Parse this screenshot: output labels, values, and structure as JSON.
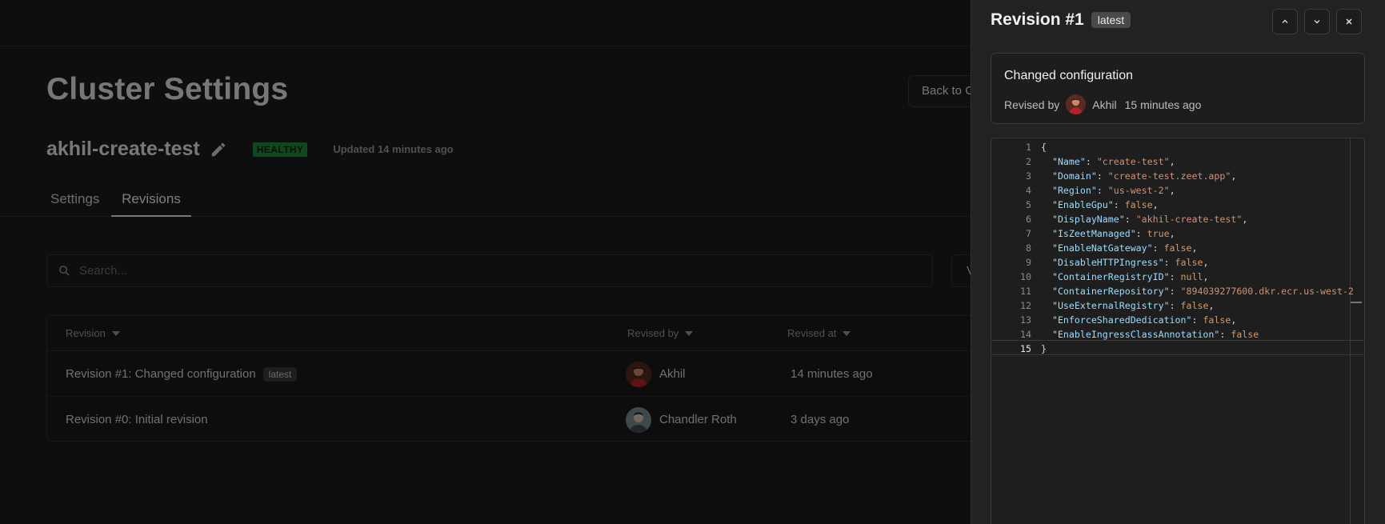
{
  "page": {
    "title": "Cluster Settings",
    "back_button": "Back to C",
    "cluster_name": "akhil-create-test",
    "health": "HEALTHY",
    "updated": "Updated 14 minutes ago",
    "tabs": [
      {
        "label": "Settings"
      },
      {
        "label": "Revisions",
        "active": true
      }
    ],
    "search_placeholder": "Search...",
    "view_button": "V",
    "table": {
      "headers": [
        "Revision",
        "Revised by",
        "Revised at"
      ],
      "rows": [
        {
          "revision": "Revision #1: Changed configuration",
          "badge": "latest",
          "user": "Akhil",
          "at": "14 minutes ago"
        },
        {
          "revision": "Revision #0: Initial revision",
          "badge": "",
          "user": "Chandler Roth",
          "at": "3 days ago"
        }
      ]
    }
  },
  "drawer": {
    "title": "Revision #1",
    "badge": "latest",
    "summary_title": "Changed configuration",
    "revised_by_label": "Revised by",
    "revised_by_user": "Akhil",
    "revised_time": "15 minutes ago",
    "active_line": 15,
    "code_lines": [
      {
        "n": "1",
        "parts": [
          [
            "p",
            "{"
          ]
        ]
      },
      {
        "n": "2",
        "parts": [
          [
            "p",
            "  "
          ],
          [
            "k",
            "\"Name\""
          ],
          [
            "p",
            ": "
          ],
          [
            "s",
            "\"create-test\""
          ],
          [
            "p",
            ","
          ]
        ]
      },
      {
        "n": "3",
        "parts": [
          [
            "p",
            "  "
          ],
          [
            "k",
            "\"Domain\""
          ],
          [
            "p",
            ": "
          ],
          [
            "s",
            "\"create-test.zeet.app\""
          ],
          [
            "p",
            ","
          ]
        ]
      },
      {
        "n": "4",
        "parts": [
          [
            "p",
            "  "
          ],
          [
            "k",
            "\"Region\""
          ],
          [
            "p",
            ": "
          ],
          [
            "s",
            "\"us-west-2\""
          ],
          [
            "p",
            ","
          ]
        ]
      },
      {
        "n": "5",
        "parts": [
          [
            "p",
            "  "
          ],
          [
            "k",
            "\"EnableGpu\""
          ],
          [
            "p",
            ": "
          ],
          [
            "b",
            "false"
          ],
          [
            "p",
            ","
          ]
        ]
      },
      {
        "n": "6",
        "parts": [
          [
            "p",
            "  "
          ],
          [
            "k",
            "\"DisplayName\""
          ],
          [
            "p",
            ": "
          ],
          [
            "s",
            "\"akhil-create-test\""
          ],
          [
            "p",
            ","
          ]
        ]
      },
      {
        "n": "7",
        "parts": [
          [
            "p",
            "  "
          ],
          [
            "k",
            "\"IsZeetManaged\""
          ],
          [
            "p",
            ": "
          ],
          [
            "b",
            "true"
          ],
          [
            "p",
            ","
          ]
        ]
      },
      {
        "n": "8",
        "parts": [
          [
            "p",
            "  "
          ],
          [
            "k",
            "\"EnableNatGateway\""
          ],
          [
            "p",
            ": "
          ],
          [
            "b",
            "false"
          ],
          [
            "p",
            ","
          ]
        ]
      },
      {
        "n": "9",
        "parts": [
          [
            "p",
            "  "
          ],
          [
            "k",
            "\"DisableHTTPIngress\""
          ],
          [
            "p",
            ": "
          ],
          [
            "b",
            "false"
          ],
          [
            "p",
            ","
          ]
        ]
      },
      {
        "n": "10",
        "parts": [
          [
            "p",
            "  "
          ],
          [
            "k",
            "\"ContainerRegistryID\""
          ],
          [
            "p",
            ": "
          ],
          [
            "b",
            "null"
          ],
          [
            "p",
            ","
          ]
        ]
      },
      {
        "n": "11",
        "parts": [
          [
            "p",
            "  "
          ],
          [
            "k",
            "\"ContainerRepository\""
          ],
          [
            "p",
            ": "
          ],
          [
            "s",
            "\"894039277600.dkr.ecr.us-west-2"
          ]
        ]
      },
      {
        "n": "12",
        "parts": [
          [
            "p",
            "  "
          ],
          [
            "k",
            "\"UseExternalRegistry\""
          ],
          [
            "p",
            ": "
          ],
          [
            "b",
            "false"
          ],
          [
            "p",
            ","
          ]
        ]
      },
      {
        "n": "13",
        "parts": [
          [
            "p",
            "  "
          ],
          [
            "k",
            "\"EnforceSharedDedication\""
          ],
          [
            "p",
            ": "
          ],
          [
            "b",
            "false"
          ],
          [
            "p",
            ","
          ]
        ]
      },
      {
        "n": "14",
        "parts": [
          [
            "p",
            "  "
          ],
          [
            "k",
            "\"EnableIngressClassAnnotation\""
          ],
          [
            "p",
            ": "
          ],
          [
            "b",
            "false"
          ]
        ]
      },
      {
        "n": "15",
        "parts": [
          [
            "p",
            "}"
          ]
        ]
      }
    ]
  },
  "colors": {
    "healthy_badge": "#1f8a3a",
    "json_key": "#9cdcfe",
    "json_string": "#ce9178",
    "json_literal": "#d19a66"
  },
  "icons": [
    "pencil-icon",
    "search-icon",
    "caret-down-icon",
    "chevron-up-icon",
    "chevron-down-icon",
    "close-icon"
  ]
}
